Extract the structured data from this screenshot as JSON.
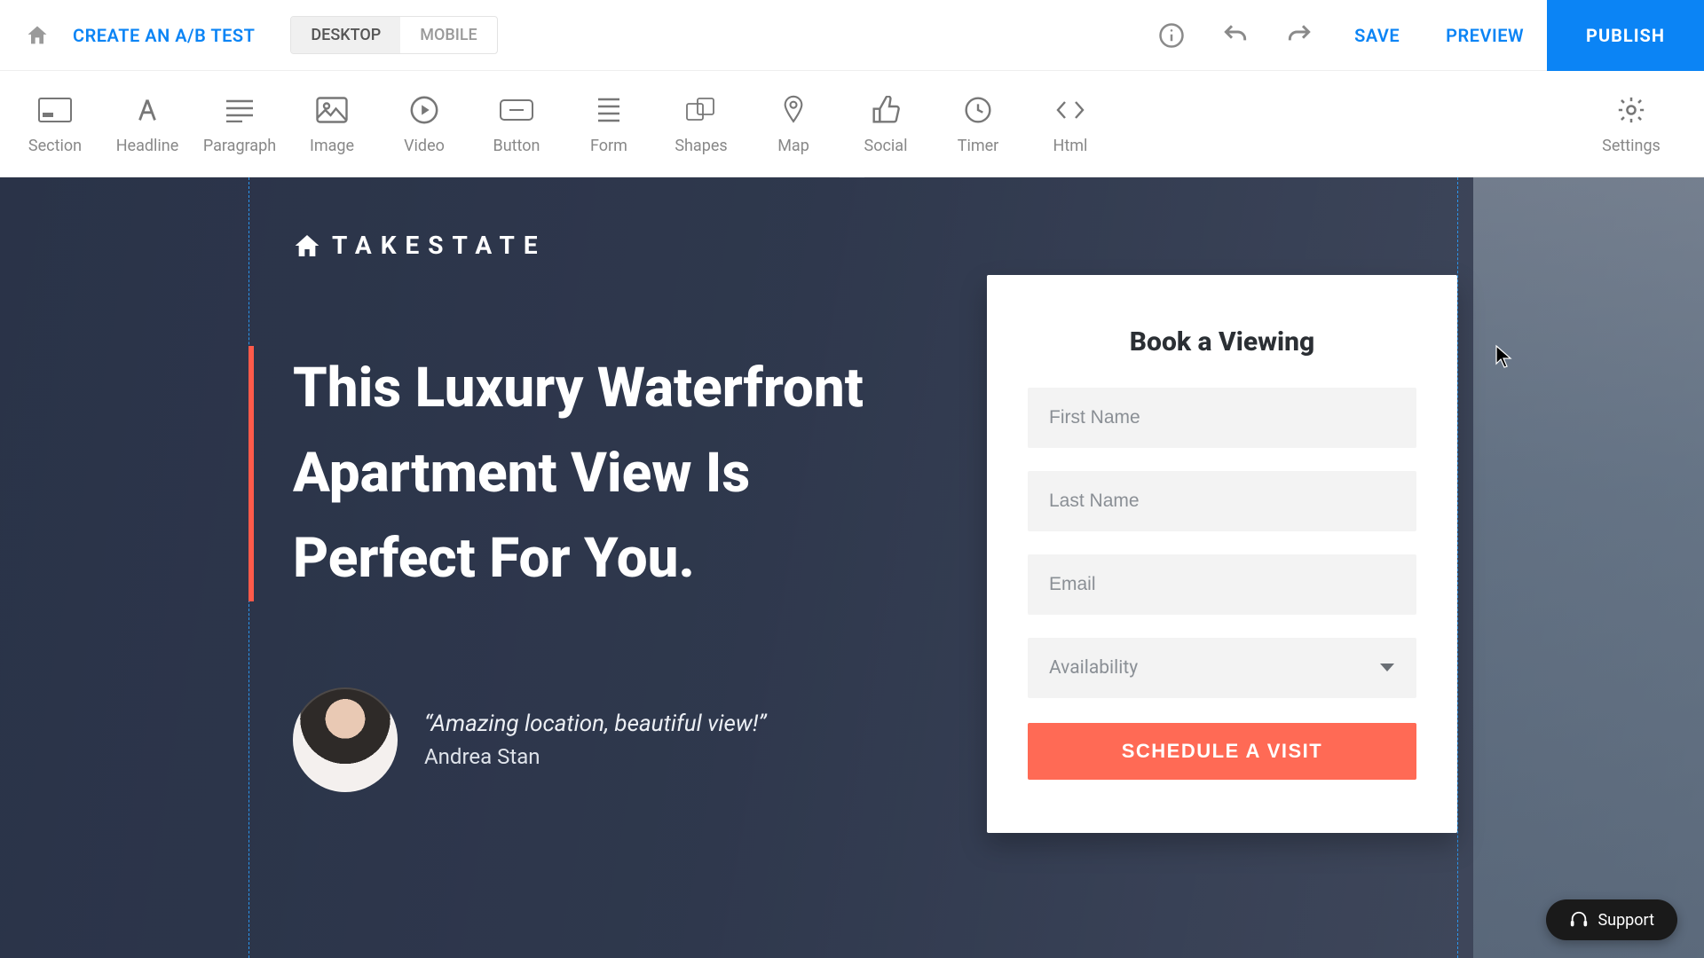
{
  "topbar": {
    "ab_test_label": "CREATE AN A/B TEST",
    "device_tabs": {
      "desktop": "DESKTOP",
      "mobile": "MOBILE",
      "active": "desktop"
    },
    "save_label": "SAVE",
    "preview_label": "PREVIEW",
    "publish_label": "PUBLISH"
  },
  "toolbelt": {
    "items": [
      {
        "label": "Section"
      },
      {
        "label": "Headline"
      },
      {
        "label": "Paragraph"
      },
      {
        "label": "Image"
      },
      {
        "label": "Video"
      },
      {
        "label": "Button"
      },
      {
        "label": "Form"
      },
      {
        "label": "Shapes"
      },
      {
        "label": "Map"
      },
      {
        "label": "Social"
      },
      {
        "label": "Timer"
      },
      {
        "label": "Html"
      }
    ],
    "settings_label": "Settings"
  },
  "page": {
    "brand": "TAKESTATE",
    "headline": "This Luxury Waterfront Apartment View Is Perfect For You.",
    "testimonial": {
      "quote": "“Amazing location, beautiful view!”",
      "author": "Andrea Stan"
    },
    "form": {
      "title": "Book a Viewing",
      "first_name_ph": "First Name",
      "last_name_ph": "Last Name",
      "email_ph": "Email",
      "availability_label": "Availability",
      "submit_label": "SCHEDULE A VISIT"
    }
  },
  "support": {
    "label": "Support"
  },
  "colors": {
    "primary_blue": "#0b84f5",
    "accent_coral": "#ff6a55",
    "marker_red": "#ff5a4a"
  }
}
